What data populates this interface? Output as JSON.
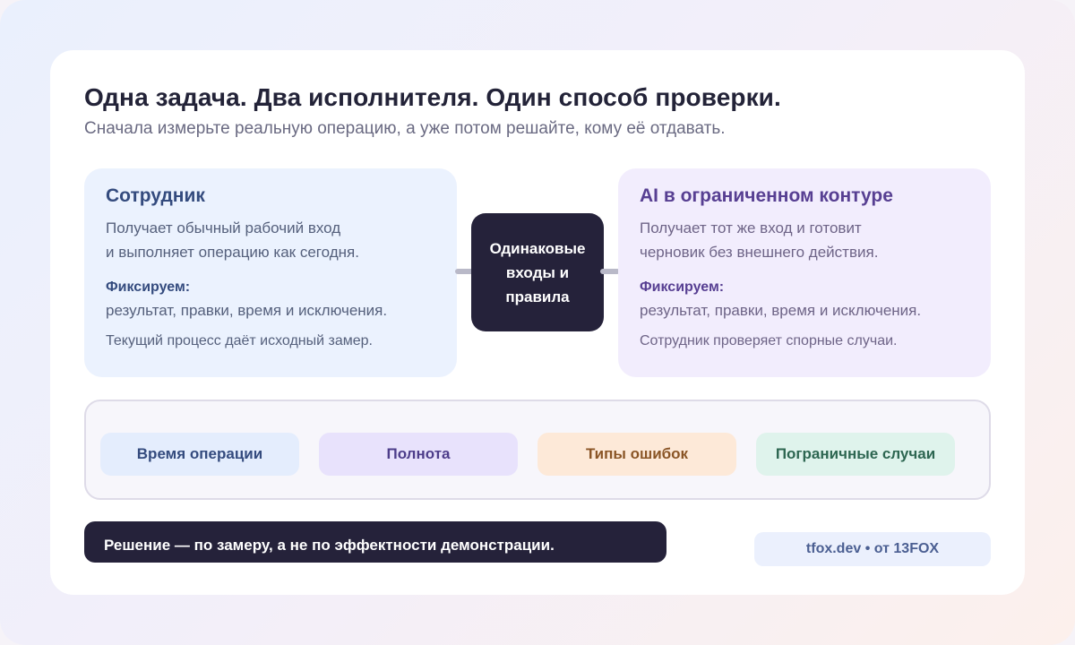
{
  "header": {
    "title": "Одна задача. Два исполнителя. Один способ проверки.",
    "subtitle": "Сначала измерьте реальную операцию, а уже потом решайте, кому её отдавать."
  },
  "left_panel": {
    "title": "Сотрудник",
    "desc_line1": "Получает обычный рабочий вход",
    "desc_line2": "и выполняет операцию как сегодня.",
    "track_label": "Фиксируем:",
    "track_value": "результат, правки, время и исключения.",
    "note": "Текущий процесс даёт исходный замер."
  },
  "center": {
    "line1": "Одинаковые",
    "line2": "входы и",
    "line3": "правила"
  },
  "right_panel": {
    "title": "AI в ограниченном контуре",
    "desc_line1": "Получает тот же вход и готовит",
    "desc_line2": "черновик без внешнего действия.",
    "track_label": "Фиксируем:",
    "track_value": "результат, правки, время и исключения.",
    "note": "Сотрудник проверяет спорные случаи."
  },
  "metrics": [
    "Время операции",
    "Полнота",
    "Типы ошибок",
    "Пограничные случаи"
  ],
  "decision": "Решение — по замеру, а не по эффектности демонстрации.",
  "footer_tag": "tfox.dev • от 13FOX",
  "colors": {
    "dark": "#25223a",
    "employee_accent": "#344b7e",
    "ai_accent": "#573f92"
  }
}
